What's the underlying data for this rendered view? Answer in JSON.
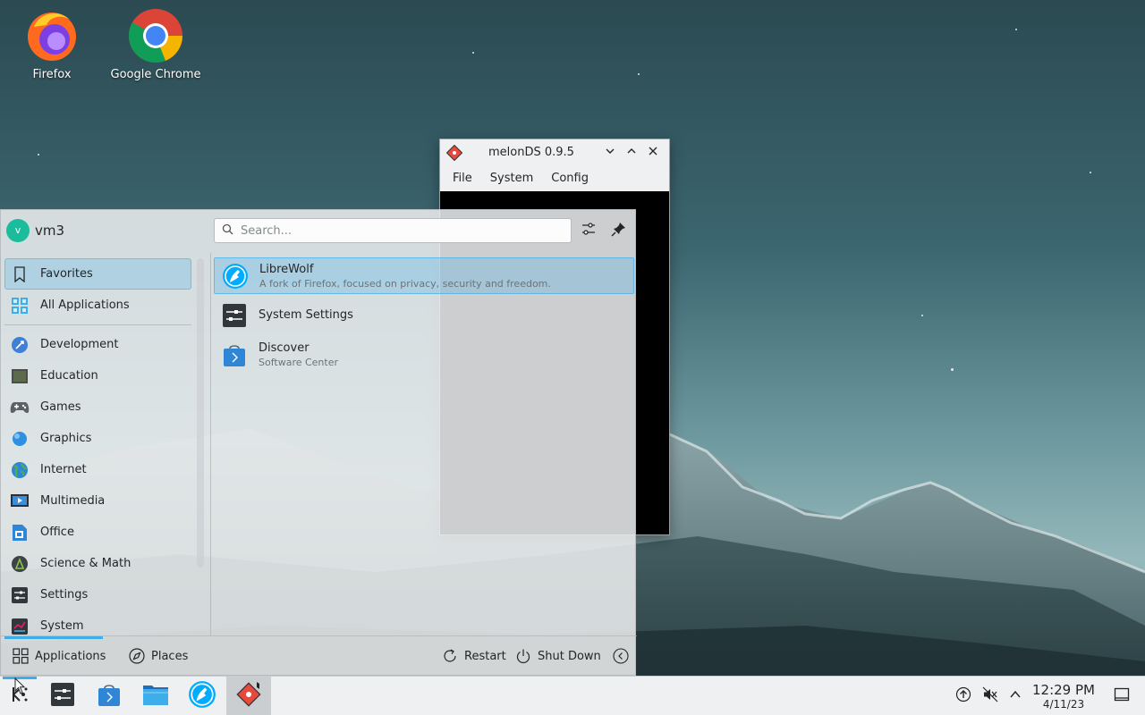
{
  "desktop": {
    "icons": [
      {
        "label": "Firefox",
        "icon": "firefox-icon"
      },
      {
        "label": "Google Chrome",
        "icon": "chrome-icon"
      }
    ]
  },
  "melon_window": {
    "title": "melonDS 0.9.5",
    "controls": [
      "minimize",
      "maximize",
      "close"
    ],
    "menu": [
      "File",
      "System",
      "Config"
    ]
  },
  "launcher": {
    "user": {
      "initial": "v",
      "name": "vm3"
    },
    "search": {
      "placeholder": "Search..."
    },
    "categories": [
      {
        "label": "Favorites",
        "icon": "bookmark-icon",
        "selected": true
      },
      {
        "label": "All Applications",
        "icon": "grid-icon"
      },
      {
        "label": "Development",
        "icon": "development-icon"
      },
      {
        "label": "Education",
        "icon": "education-icon"
      },
      {
        "label": "Games",
        "icon": "gamepad-icon"
      },
      {
        "label": "Graphics",
        "icon": "graphics-icon"
      },
      {
        "label": "Internet",
        "icon": "globe-icon"
      },
      {
        "label": "Multimedia",
        "icon": "multimedia-icon"
      },
      {
        "label": "Office",
        "icon": "office-icon"
      },
      {
        "label": "Science & Math",
        "icon": "science-icon"
      },
      {
        "label": "Settings",
        "icon": "settings-icon"
      },
      {
        "label": "System",
        "icon": "system-icon"
      }
    ],
    "favorites": [
      {
        "name": "LibreWolf",
        "description": "A fork of Firefox, focused on privacy, security and freedom.",
        "highlighted": true
      },
      {
        "name": "System Settings",
        "description": ""
      },
      {
        "name": "Discover",
        "description": "Software Center"
      }
    ],
    "footer": {
      "applications": "Applications",
      "places": "Places",
      "restart": "Restart",
      "shutdown": "Shut Down"
    }
  },
  "taskbar": {
    "items": [
      "application-launcher",
      "system-settings",
      "discover",
      "file-manager",
      "librewolf",
      "melonds"
    ],
    "clock": {
      "time": "12:29 PM",
      "date": "4/11/23"
    }
  },
  "colors": {
    "accent": "#3daee9",
    "panel": "#eff0f1"
  }
}
